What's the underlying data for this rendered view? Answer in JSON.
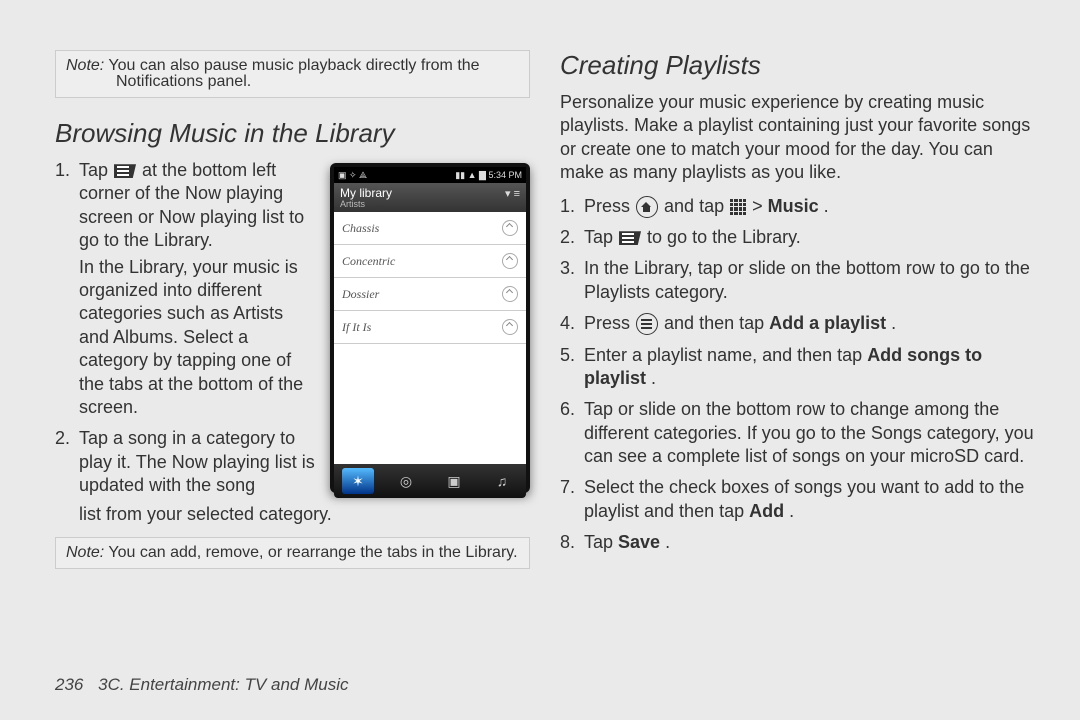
{
  "left": {
    "note1": {
      "label": "Note:",
      "line1": "You can also pause music playback directly from the",
      "line2": "Notifications panel."
    },
    "heading": "Browsing Music in the Library",
    "step1a": "Tap ",
    "step1b": " at the bottom left corner of the Now playing screen or Now playing list to go to the Library.",
    "step1para2": "In the Library, your music is organized into different categories such as Artists and Albums. Select a category by tapping one of the tabs at the bottom of the screen.",
    "step2a": "Tap a song in a category to play it. The Now playing list is updated with the song",
    "step2b": "list from your selected category.",
    "note2": {
      "label": "Note:",
      "text": "You can add, remove, or rearrange the tabs in the Library."
    }
  },
  "phone": {
    "status_left": "▣ ✧ ⟁",
    "status_right": "▮▮ ▲ ▇ 5:34 PM",
    "hdr_title": "My library",
    "hdr_sub": "Artists",
    "hdr_icons": "▾   ≡",
    "rows": [
      "Chassis",
      "Concentric",
      "Dossier",
      "If It Is"
    ],
    "tabs": [
      "✶",
      "◎",
      "▣",
      "♫"
    ]
  },
  "right": {
    "heading": "Creating Playlists",
    "intro": "Personalize your music experience by creating music playlists. Make a playlist containing just your favorite songs or create one to match your mood for the day. You can make as many playlists as you like.",
    "step1a": "Press ",
    "step1b": " and tap ",
    "step1c": " > ",
    "step1d": "Music",
    "step1e": ".",
    "step2a": "Tap ",
    "step2b": " to go to the Library.",
    "step3": "In the Library, tap or slide on the bottom row to go to the Playlists category.",
    "step4a": "Press ",
    "step4b": " and then tap ",
    "step4c": "Add a playlist",
    "step4d": ".",
    "step5a": "Enter a playlist name, and then tap ",
    "step5b": "Add songs to playlist",
    "step5c": ".",
    "step6": "Tap or slide on the bottom row to change among the different categories. If you go to the Songs category, you can see a complete list of songs on your microSD card.",
    "step7a": "Select the check boxes of songs you want to add to the playlist and then tap ",
    "step7b": "Add",
    "step7c": ".",
    "step8a": "Tap ",
    "step8b": "Save",
    "step8c": "."
  },
  "footer": {
    "page": "236",
    "chapter": "3C. Entertainment: TV and Music"
  }
}
